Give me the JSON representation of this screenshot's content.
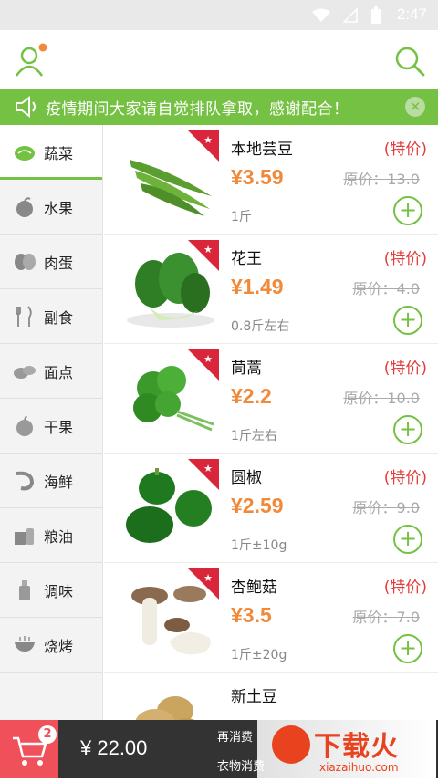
{
  "status": {
    "time": "2:47"
  },
  "notice": {
    "text": "疫情期间大家请自觉排队拿取，感谢配合！"
  },
  "categories": [
    {
      "label": "蔬菜",
      "icon": "vegetable-icon",
      "active": true
    },
    {
      "label": "水果",
      "icon": "fruit-icon"
    },
    {
      "label": "肉蛋",
      "icon": "meat-egg-icon"
    },
    {
      "label": "副食",
      "icon": "utensils-icon"
    },
    {
      "label": "面点",
      "icon": "pastry-icon"
    },
    {
      "label": "干果",
      "icon": "dried-fruit-icon"
    },
    {
      "label": "海鲜",
      "icon": "shrimp-icon"
    },
    {
      "label": "粮油",
      "icon": "grain-oil-icon"
    },
    {
      "label": "调味",
      "icon": "seasoning-icon"
    },
    {
      "label": "烧烤",
      "icon": "bbq-icon"
    }
  ],
  "products": [
    {
      "name": "本地芸豆",
      "price": "¥3.59",
      "unit": "1斤",
      "tag": "(特价)",
      "original": "原价：13.0",
      "img": "green-beans"
    },
    {
      "name": "花王",
      "price": "¥1.49",
      "unit": "0.8斤左右",
      "tag": "(特价)",
      "original": "原价：4.0",
      "img": "bok-choy"
    },
    {
      "name": "茼蒿",
      "price": "¥2.2",
      "unit": "1斤左右",
      "tag": "(特价)",
      "original": "原价：10.0",
      "img": "crown-daisy"
    },
    {
      "name": "圆椒",
      "price": "¥2.59",
      "unit": "1斤±10g",
      "tag": "(特价)",
      "original": "原价：9.0",
      "img": "bell-pepper"
    },
    {
      "name": "杏鲍菇",
      "price": "¥3.5",
      "unit": "1斤±20g",
      "tag": "(特价)",
      "original": "原价：7.0",
      "img": "mushroom"
    },
    {
      "name": "新土豆",
      "price": "",
      "unit": "",
      "tag": "",
      "original": "",
      "img": "potato"
    }
  ],
  "cart": {
    "count": "2",
    "total": "¥ 22.00",
    "promo_line1": "再消费",
    "promo_line2": "衣物消费"
  },
  "watermark": {
    "title": "下载火",
    "sub": "xiazaihuo.com"
  },
  "colors": {
    "brand_green": "#75c143",
    "price_orange": "#f08a3a",
    "special_red": "#e23c3c",
    "cart_red": "#f0505a"
  }
}
